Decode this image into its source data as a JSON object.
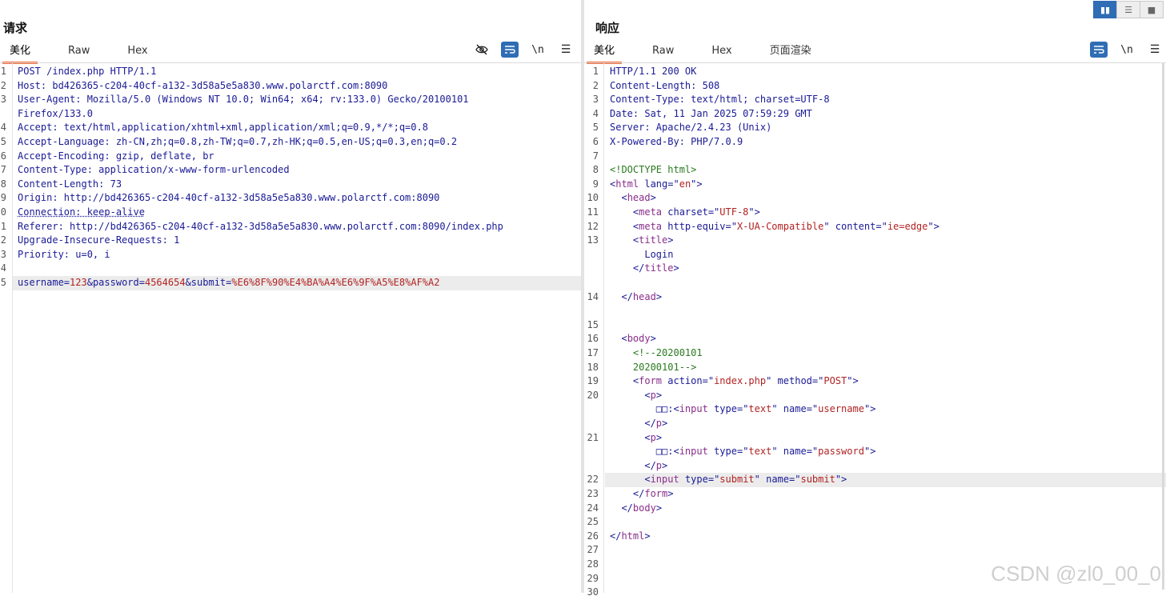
{
  "request": {
    "title": "请求",
    "tabs": [
      "美化",
      "Raw",
      "Hex"
    ],
    "active_tab": 0,
    "toolbar_icons": [
      "eye-slash-icon",
      "wrap-icon",
      "newline-icon",
      "menu-icon"
    ],
    "lines": [
      {
        "n": "1",
        "segs": [
          [
            "p",
            "POST /index.php HTTP/1.1"
          ]
        ]
      },
      {
        "n": "2",
        "segs": [
          [
            "k",
            "Host"
          ],
          [
            "p",
            ": bd426365-c204-40cf-a132-3d58a5e5a830.www.polarctf.com:8090"
          ]
        ]
      },
      {
        "n": "3",
        "segs": [
          [
            "k",
            "User-Agent"
          ],
          [
            "p",
            ": Mozilla/5.0 (Windows NT 10.0; Win64; x64; rv:133.0) Gecko/20100101"
          ]
        ]
      },
      {
        "n": "",
        "segs": [
          [
            "p",
            "Firefox/133.0"
          ]
        ]
      },
      {
        "n": "4",
        "segs": [
          [
            "k",
            "Accept"
          ],
          [
            "p",
            ": text/html,application/xhtml+xml,application/xml;q=0.9,*/*;q=0.8"
          ]
        ]
      },
      {
        "n": "5",
        "segs": [
          [
            "k",
            "Accept-Language"
          ],
          [
            "p",
            ": zh-CN,zh;q=0.8,zh-TW;q=0.7,zh-HK;q=0.5,en-US;q=0.3,en;q=0.2"
          ]
        ]
      },
      {
        "n": "6",
        "segs": [
          [
            "k",
            "Accept-Encoding"
          ],
          [
            "p",
            ": gzip, deflate, br"
          ]
        ]
      },
      {
        "n": "7",
        "segs": [
          [
            "k",
            "Content-Type"
          ],
          [
            "p",
            ": application/x-www-form-urlencoded"
          ]
        ]
      },
      {
        "n": "8",
        "segs": [
          [
            "k",
            "Content-Length"
          ],
          [
            "p",
            ": 73"
          ]
        ]
      },
      {
        "n": "9",
        "segs": [
          [
            "k",
            "Origin"
          ],
          [
            "p",
            ": http://bd426365-c204-40cf-a132-3d58a5e5a830.www.polarctf.com:8090"
          ]
        ]
      },
      {
        "n": "0",
        "segs": [
          [
            "kd",
            "Connection: keep-alive"
          ]
        ]
      },
      {
        "n": "1",
        "segs": [
          [
            "k",
            "Referer"
          ],
          [
            "p",
            ": http://bd426365-c204-40cf-a132-3d58a5e5a830.www.polarctf.com:8090/index.php"
          ]
        ]
      },
      {
        "n": "2",
        "segs": [
          [
            "k",
            "Upgrade-Insecure-Requests"
          ],
          [
            "p",
            ": 1"
          ]
        ]
      },
      {
        "n": "3",
        "segs": [
          [
            "k",
            "Priority"
          ],
          [
            "p",
            ": u=0, i"
          ]
        ]
      },
      {
        "n": "4",
        "segs": []
      },
      {
        "n": "5",
        "hl": true,
        "segs": [
          [
            "k",
            "username"
          ],
          [
            "p",
            "="
          ],
          [
            "v",
            "123"
          ],
          [
            "p",
            "&"
          ],
          [
            "k",
            "password"
          ],
          [
            "p",
            "="
          ],
          [
            "v",
            "4564654"
          ],
          [
            "p",
            "&"
          ],
          [
            "k",
            "submit"
          ],
          [
            "p",
            "="
          ],
          [
            "v",
            "%E6%8F%90%E4%BA%A4%E6%9F%A5%E8%AF%A2"
          ]
        ]
      }
    ]
  },
  "response": {
    "title": "响应",
    "tabs": [
      "美化",
      "Raw",
      "Hex",
      "页面渲染"
    ],
    "active_tab": 0,
    "toolbar_icons": [
      "wrap-icon",
      "newline-icon",
      "menu-icon"
    ],
    "lines": [
      {
        "n": "1",
        "segs": [
          [
            "p",
            "HTTP/1.1 200 OK"
          ]
        ]
      },
      {
        "n": "2",
        "segs": [
          [
            "k",
            "Content-Length"
          ],
          [
            "p",
            ": 508"
          ]
        ]
      },
      {
        "n": "3",
        "segs": [
          [
            "k",
            "Content-Type"
          ],
          [
            "p",
            ": text/html; charset=UTF-8"
          ]
        ]
      },
      {
        "n": "4",
        "segs": [
          [
            "k",
            "Date"
          ],
          [
            "p",
            ": Sat, 11 Jan 2025 07:59:29 GMT"
          ]
        ]
      },
      {
        "n": "5",
        "segs": [
          [
            "k",
            "Server"
          ],
          [
            "p",
            ": Apache/2.4.23 (Unix)"
          ]
        ]
      },
      {
        "n": "6",
        "segs": [
          [
            "k",
            "X-Powered-By"
          ],
          [
            "p",
            ": PHP/7.0.9"
          ]
        ]
      },
      {
        "n": "7",
        "segs": []
      },
      {
        "n": "8",
        "segs": [
          [
            "c",
            "<!DOCTYPE html>"
          ]
        ]
      },
      {
        "n": "9",
        "segs": [
          [
            "p",
            "<"
          ],
          [
            "t",
            "html "
          ],
          [
            "a",
            "lang"
          ],
          [
            "p",
            "=\""
          ],
          [
            "s",
            "en"
          ],
          [
            "p",
            "\">"
          ]
        ]
      },
      {
        "n": "10",
        "segs": [
          [
            "p",
            "  <"
          ],
          [
            "t",
            "head"
          ],
          [
            "p",
            ">"
          ]
        ]
      },
      {
        "n": "11",
        "segs": [
          [
            "p",
            "    <"
          ],
          [
            "t",
            "meta "
          ],
          [
            "a",
            "charset"
          ],
          [
            "p",
            "=\""
          ],
          [
            "s",
            "UTF-8"
          ],
          [
            "p",
            "\">"
          ]
        ]
      },
      {
        "n": "12",
        "segs": [
          [
            "p",
            "    <"
          ],
          [
            "t",
            "meta "
          ],
          [
            "a",
            "http-equiv"
          ],
          [
            "p",
            "=\""
          ],
          [
            "s",
            "X-UA-Compatible"
          ],
          [
            "p",
            "\" "
          ],
          [
            "a",
            "content"
          ],
          [
            "p",
            "=\""
          ],
          [
            "s",
            "ie=edge"
          ],
          [
            "p",
            "\">"
          ]
        ]
      },
      {
        "n": "13",
        "segs": [
          [
            "p",
            "    <"
          ],
          [
            "t",
            "title"
          ],
          [
            "p",
            ">"
          ]
        ]
      },
      {
        "n": "",
        "segs": [
          [
            "p",
            "      Login"
          ]
        ]
      },
      {
        "n": "",
        "segs": [
          [
            "p",
            "    </"
          ],
          [
            "t",
            "title"
          ],
          [
            "p",
            ">"
          ]
        ]
      },
      {
        "n": "",
        "segs": []
      },
      {
        "n": "14",
        "segs": [
          [
            "p",
            "  </"
          ],
          [
            "t",
            "head"
          ],
          [
            "p",
            ">"
          ]
        ]
      },
      {
        "n": "",
        "segs": []
      },
      {
        "n": "15",
        "segs": []
      },
      {
        "n": "16",
        "segs": [
          [
            "p",
            "  <"
          ],
          [
            "t",
            "body"
          ],
          [
            "p",
            ">"
          ]
        ]
      },
      {
        "n": "17",
        "segs": [
          [
            "c",
            "    <!--20200101"
          ]
        ]
      },
      {
        "n": "18",
        "segs": [
          [
            "c",
            "    20200101-->"
          ]
        ]
      },
      {
        "n": "19",
        "segs": [
          [
            "p",
            "    <"
          ],
          [
            "t",
            "form "
          ],
          [
            "a",
            "action"
          ],
          [
            "p",
            "=\""
          ],
          [
            "s",
            "index.php"
          ],
          [
            "p",
            "\" "
          ],
          [
            "a",
            "method"
          ],
          [
            "p",
            "=\""
          ],
          [
            "s",
            "POST"
          ],
          [
            "p",
            "\">"
          ]
        ]
      },
      {
        "n": "20",
        "segs": [
          [
            "p",
            "      <"
          ],
          [
            "t",
            "p"
          ],
          [
            "p",
            ">"
          ]
        ]
      },
      {
        "n": "",
        "segs": [
          [
            "p",
            "        □□:<"
          ],
          [
            "t",
            "input "
          ],
          [
            "a",
            "type"
          ],
          [
            "p",
            "=\""
          ],
          [
            "s",
            "text"
          ],
          [
            "p",
            "\" "
          ],
          [
            "a",
            "name"
          ],
          [
            "p",
            "=\""
          ],
          [
            "s",
            "username"
          ],
          [
            "p",
            "\">"
          ]
        ]
      },
      {
        "n": "",
        "segs": [
          [
            "p",
            "      </"
          ],
          [
            "t",
            "p"
          ],
          [
            "p",
            ">"
          ]
        ]
      },
      {
        "n": "21",
        "segs": [
          [
            "p",
            "      <"
          ],
          [
            "t",
            "p"
          ],
          [
            "p",
            ">"
          ]
        ]
      },
      {
        "n": "",
        "segs": [
          [
            "p",
            "        □□:<"
          ],
          [
            "t",
            "input "
          ],
          [
            "a",
            "type"
          ],
          [
            "p",
            "=\""
          ],
          [
            "s",
            "text"
          ],
          [
            "p",
            "\" "
          ],
          [
            "a",
            "name"
          ],
          [
            "p",
            "=\""
          ],
          [
            "s",
            "password"
          ],
          [
            "p",
            "\">"
          ]
        ]
      },
      {
        "n": "",
        "segs": [
          [
            "p",
            "      </"
          ],
          [
            "t",
            "p"
          ],
          [
            "p",
            ">"
          ]
        ]
      },
      {
        "n": "22",
        "hl": true,
        "segs": [
          [
            "p",
            "      <"
          ],
          [
            "t",
            "input "
          ],
          [
            "a",
            "type"
          ],
          [
            "p",
            "=\""
          ],
          [
            "s",
            "submit"
          ],
          [
            "p",
            "\" "
          ],
          [
            "a",
            "name"
          ],
          [
            "p",
            "=\""
          ],
          [
            "s",
            "submit"
          ],
          [
            "p",
            "\">"
          ]
        ]
      },
      {
        "n": "23",
        "segs": [
          [
            "p",
            "    </"
          ],
          [
            "t",
            "form"
          ],
          [
            "p",
            ">"
          ]
        ]
      },
      {
        "n": "24",
        "segs": [
          [
            "p",
            "  </"
          ],
          [
            "t",
            "body"
          ],
          [
            "p",
            ">"
          ]
        ]
      },
      {
        "n": "25",
        "segs": []
      },
      {
        "n": "26",
        "segs": [
          [
            "p",
            "</"
          ],
          [
            "t",
            "html"
          ],
          [
            "p",
            ">"
          ]
        ]
      },
      {
        "n": "27",
        "segs": []
      },
      {
        "n": "28",
        "segs": []
      },
      {
        "n": "29",
        "segs": []
      },
      {
        "n": "30",
        "segs": []
      }
    ]
  },
  "view_switch": [
    "split-horizontal-icon",
    "split-vertical-icon",
    "single-pane-icon"
  ],
  "watermark": "CSDN @zl0_00_0"
}
